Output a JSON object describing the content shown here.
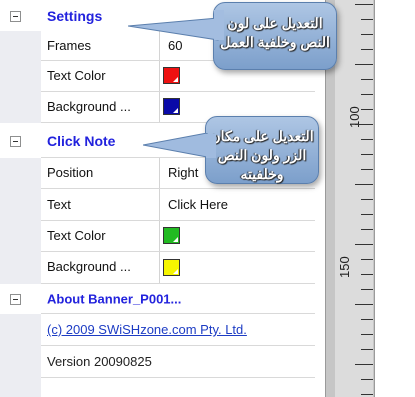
{
  "panel": {
    "settings": {
      "label": "Settings",
      "rows": [
        {
          "name": "Frames",
          "value": "60"
        },
        {
          "name": "Text Color",
          "color": "#ee1111"
        },
        {
          "name": "Background ...",
          "color": "#0a0aa8"
        }
      ]
    },
    "click_note": {
      "label": "Click Note",
      "rows": [
        {
          "name": "Position",
          "value": "Right"
        },
        {
          "name": "Text",
          "value": "Click Here"
        },
        {
          "name": "Text Color",
          "color": "#22bb22"
        },
        {
          "name": "Background ...",
          "color": "#f5f500"
        }
      ]
    },
    "about": {
      "label": "About Banner_P001...",
      "copyright": "(c) 2009 SWiSHzone.com Pty. Ltd.",
      "version": "Version 20090825"
    }
  },
  "ruler": {
    "labels": [
      "100",
      "150"
    ]
  },
  "callouts": {
    "first": "التعديل على لون النص وخلفية العمل",
    "second": "التعديل على مكان الزر ولون النص وخلفيته"
  },
  "colors": {
    "category_text": "#2222dd",
    "link_text": "#1d3cc4",
    "callout_fill": "#8eb0d8"
  }
}
